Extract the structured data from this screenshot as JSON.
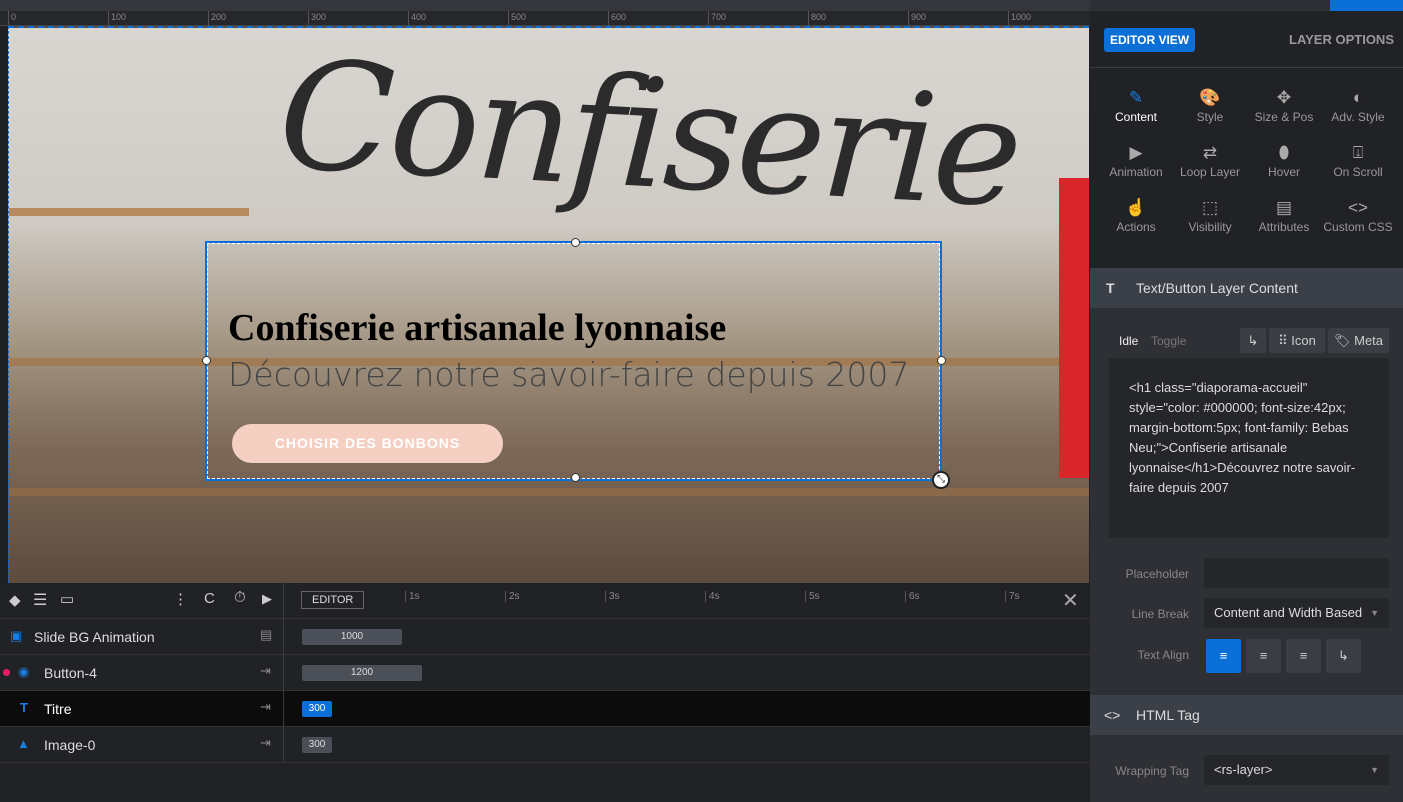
{
  "ruler": {
    "ticks": [
      "0",
      "100",
      "200",
      "300",
      "400",
      "500",
      "600",
      "700",
      "800",
      "900",
      "1000"
    ]
  },
  "canvas": {
    "sign_text": "Confiserie",
    "heading": "Confiserie artisanale lyonnaise",
    "subheading": "Découvrez notre savoir-faire depuis 2007",
    "cta": "CHOISIR DES BONBONS"
  },
  "timeline": {
    "editor_label": "EDITOR",
    "seconds": [
      "1s",
      "2s",
      "3s",
      "4s",
      "5s",
      "6s",
      "7s"
    ],
    "layers": [
      {
        "name": "Slide BG Animation",
        "duration": "1000"
      },
      {
        "name": "Button-4",
        "duration": "1200"
      },
      {
        "name": "Titre",
        "duration": "300"
      },
      {
        "name": "Image-0",
        "duration": "300"
      }
    ]
  },
  "panel": {
    "editor_view": "EDITOR VIEW",
    "layer_options": "LAYER OPTIONS",
    "tabs": [
      {
        "label": "Content",
        "icon": "pencil"
      },
      {
        "label": "Style",
        "icon": "palette"
      },
      {
        "label": "Size & Pos",
        "icon": "move"
      },
      {
        "label": "Adv. Style",
        "icon": "contrast"
      },
      {
        "label": "Animation",
        "icon": "play"
      },
      {
        "label": "Loop Layer",
        "icon": "repeat"
      },
      {
        "label": "Hover",
        "icon": "mouse"
      },
      {
        "label": "On Scroll",
        "icon": "download-box"
      },
      {
        "label": "Actions",
        "icon": "touch"
      },
      {
        "label": "Visibility",
        "icon": "image-dashed"
      },
      {
        "label": "Attributes",
        "icon": "document"
      },
      {
        "label": "Custom CSS",
        "icon": "code"
      }
    ],
    "content_section": "Text/Button Layer Content",
    "idle": "Idle",
    "toggle": "Toggle",
    "icon_btn": "Icon",
    "meta_btn": "Meta",
    "code": "<h1 class=\"diaporama-accueil\" style=\"color: #000000; font-size:42px; margin-bottom:5px; font-family: Bebas Neu;\">Confiserie artisanale lyonnaise</h1>Découvrez notre savoir-faire depuis 2007",
    "placeholder_label": "Placeholder",
    "placeholder_value": "",
    "line_break_label": "Line Break",
    "line_break_value": "Content and Width Based",
    "text_align_label": "Text Align",
    "text_align_value": "left",
    "html_tag_section": "HTML Tag",
    "wrapping_tag_label": "Wrapping Tag",
    "wrapping_tag_value": "<rs-layer>"
  },
  "colors": {
    "accent": "#0a6fd6",
    "cta": "#f5d0c2",
    "marker": "#e91e63"
  }
}
